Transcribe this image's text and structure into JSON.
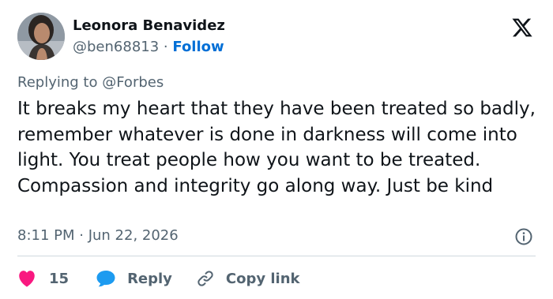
{
  "author": {
    "name": "Leonora Benavidez",
    "handle": "@ben68813",
    "separator": "·",
    "follow_label": "Follow"
  },
  "reply_context": {
    "prefix": "Replying to",
    "mention": "@Forbes"
  },
  "tweet": {
    "text": "It breaks my heart that they have been treated so badly, remember whatever is done in darkness will come into light. You treat people how you want to be treated. Compassion and integrity go along way. Just be kind",
    "timestamp": "8:11 PM · Jun 22, 2026"
  },
  "actions": {
    "like_count": "15",
    "reply_label": "Reply",
    "copy_link_label": "Copy link"
  },
  "icons": {
    "brand": "x-logo-icon",
    "info": "info-icon",
    "like": "heart-icon",
    "reply": "reply-bubble-icon",
    "copy": "link-icon"
  },
  "colors": {
    "text": "#0f1419",
    "secondary": "#536471",
    "link": "#006fd6",
    "like": "#f91880",
    "reply": "#1d9bf0",
    "divider": "#cfd9de"
  }
}
